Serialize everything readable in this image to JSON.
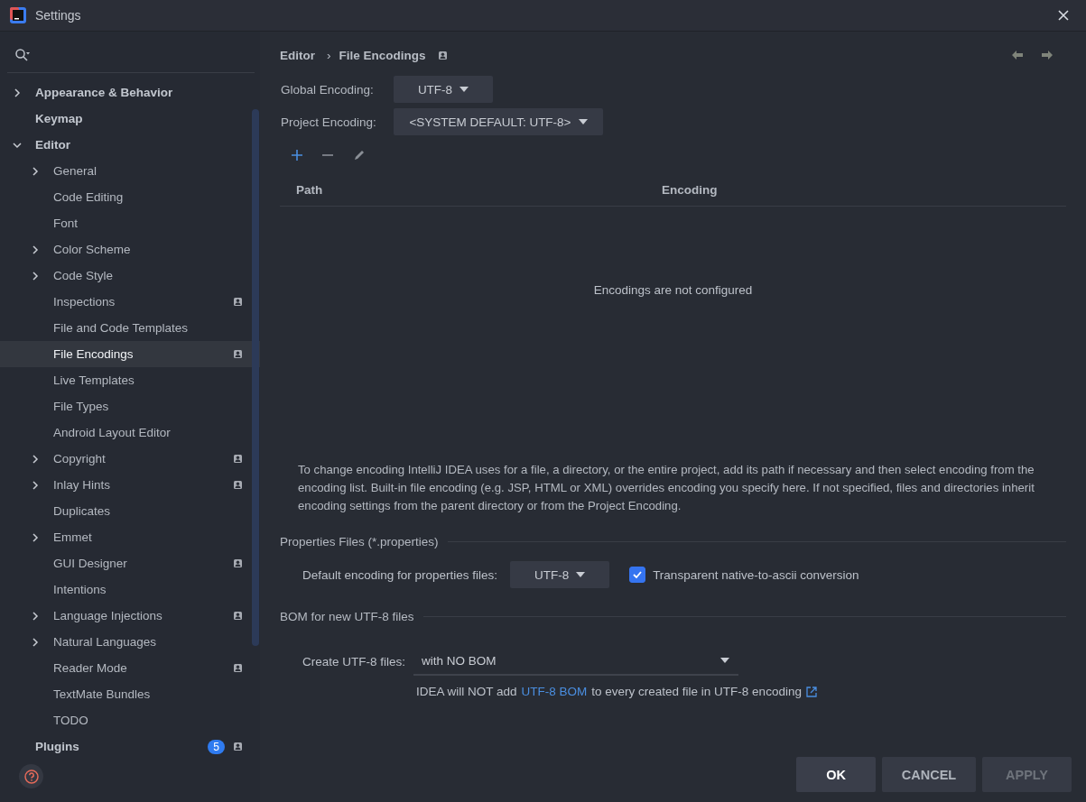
{
  "window": {
    "title": "Settings"
  },
  "sidebar": {
    "items": [
      {
        "label": "Appearance & Behavior",
        "expanded": false,
        "selected": false,
        "project_level": false
      },
      {
        "label": "Keymap",
        "selected": false,
        "project_level": false
      },
      {
        "label": "Editor",
        "expanded": true,
        "selected": false,
        "project_level": false,
        "children": [
          {
            "label": "General",
            "expanded": false,
            "selected": false,
            "project_level": false
          },
          {
            "label": "Code Editing",
            "selected": false,
            "project_level": false
          },
          {
            "label": "Font",
            "selected": false,
            "project_level": false
          },
          {
            "label": "Color Scheme",
            "expanded": false,
            "selected": false,
            "project_level": false
          },
          {
            "label": "Code Style",
            "expanded": false,
            "selected": false,
            "project_level": false
          },
          {
            "label": "Inspections",
            "selected": false,
            "project_level": true
          },
          {
            "label": "File and Code Templates",
            "selected": false,
            "project_level": false
          },
          {
            "label": "File Encodings",
            "selected": true,
            "project_level": true
          },
          {
            "label": "Live Templates",
            "selected": false,
            "project_level": false
          },
          {
            "label": "File Types",
            "selected": false,
            "project_level": false
          },
          {
            "label": "Android Layout Editor",
            "selected": false,
            "project_level": false
          },
          {
            "label": "Copyright",
            "expanded": false,
            "selected": false,
            "project_level": true
          },
          {
            "label": "Inlay Hints",
            "expanded": false,
            "selected": false,
            "project_level": true
          },
          {
            "label": "Duplicates",
            "selected": false,
            "project_level": false
          },
          {
            "label": "Emmet",
            "expanded": false,
            "selected": false,
            "project_level": false
          },
          {
            "label": "GUI Designer",
            "selected": false,
            "project_level": true
          },
          {
            "label": "Intentions",
            "selected": false,
            "project_level": false
          },
          {
            "label": "Language Injections",
            "expanded": false,
            "selected": false,
            "project_level": true
          },
          {
            "label": "Natural Languages",
            "expanded": false,
            "selected": false,
            "project_level": false
          },
          {
            "label": "Reader Mode",
            "selected": false,
            "project_level": true
          },
          {
            "label": "TextMate Bundles",
            "selected": false,
            "project_level": false
          },
          {
            "label": "TODO",
            "selected": false,
            "project_level": false
          }
        ]
      },
      {
        "label": "Plugins",
        "selected": false,
        "project_level": true,
        "badge": "5"
      }
    ]
  },
  "breadcrumb": [
    "Editor",
    "›",
    "File Encodings"
  ],
  "global_encoding": {
    "label": "Global Encoding:",
    "value": "UTF-8"
  },
  "project_encoding": {
    "label": "Project Encoding:",
    "value": "<SYSTEM DEFAULT: UTF-8>"
  },
  "table": {
    "columns": [
      "Path",
      "Encoding"
    ],
    "empty_text": "Encodings are not configured"
  },
  "description": "To change encoding IntelliJ IDEA uses for a file, a directory, or the entire project, add its path if necessary and then select encoding from the encoding list. Built-in file encoding (e.g. JSP, HTML or XML) overrides encoding you specify here. If not specified, files and directories inherit encoding settings from the parent directory or from the Project Encoding.",
  "properties_files": {
    "title": "Properties Files (*.properties)",
    "label": "Default encoding for properties files:",
    "value": "UTF-8",
    "checkbox": {
      "label": "Transparent native-to-ascii conversion",
      "checked": true
    }
  },
  "bom": {
    "title": "BOM for new UTF-8 files",
    "label": "Create UTF-8 files:",
    "value": "with NO BOM",
    "note_before": "IDEA will NOT add",
    "link": "UTF-8 BOM",
    "note_after": "to every created file in UTF-8 encoding"
  },
  "buttons": [
    {
      "label": "OK",
      "kind": "default"
    },
    {
      "label": "CANCEL",
      "kind": "normal"
    },
    {
      "label": "APPLY",
      "kind": "disabled"
    }
  ]
}
